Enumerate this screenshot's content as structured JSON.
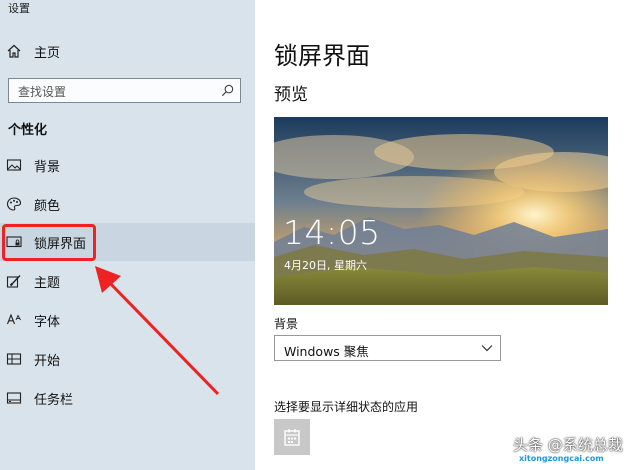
{
  "app": {
    "title": "设置"
  },
  "sidebar": {
    "home_label": "主页",
    "search_placeholder": "查找设置",
    "section_title": "个性化",
    "items": [
      {
        "label": "背景",
        "icon": "picture-icon"
      },
      {
        "label": "颜色",
        "icon": "palette-icon"
      },
      {
        "label": "锁屏界面",
        "icon": "lockscreen-icon",
        "selected": true
      },
      {
        "label": "主题",
        "icon": "brush-icon"
      },
      {
        "label": "字体",
        "icon": "font-icon"
      },
      {
        "label": "开始",
        "icon": "start-icon"
      },
      {
        "label": "任务栏",
        "icon": "taskbar-icon"
      }
    ]
  },
  "main": {
    "title": "锁屏界面",
    "preview_heading": "预览",
    "preview_time": "14:05",
    "preview_date": "4月20日, 星期六",
    "background_label": "背景",
    "background_value": "Windows 聚焦",
    "detail_status_label": "选择要显示详细状态的应用"
  },
  "watermark": {
    "text": "头条 @系统总裁",
    "subtext": "xitongzongcai.com"
  },
  "colors": {
    "highlight": "#ee2222",
    "sidebar_bg": "#d8e3ec",
    "selected_bg": "#c9d6e1"
  }
}
